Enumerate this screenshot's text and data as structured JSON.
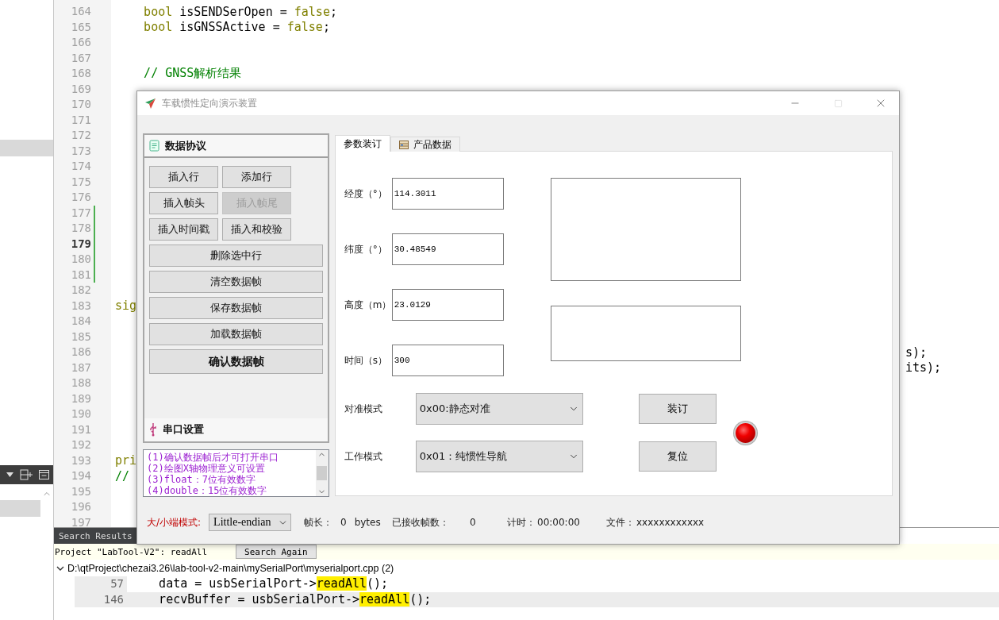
{
  "editor": {
    "lines": [
      {
        "number": "164",
        "current": false,
        "changed": false,
        "code": [
          {
            "kind": "keyword",
            "text": "    bool"
          },
          {
            "kind": "plain",
            "text": " isSENDSerOpen = "
          },
          {
            "kind": "keyword",
            "text": "false"
          },
          {
            "kind": "plain",
            "text": ";"
          }
        ]
      },
      {
        "number": "165",
        "current": false,
        "changed": false,
        "code": [
          {
            "kind": "keyword",
            "text": "    bool"
          },
          {
            "kind": "plain",
            "text": " isGNSSActive = "
          },
          {
            "kind": "keyword",
            "text": "false"
          },
          {
            "kind": "plain",
            "text": ";"
          }
        ]
      },
      {
        "number": "166",
        "current": false,
        "changed": false
      },
      {
        "number": "167",
        "current": false,
        "changed": false
      },
      {
        "number": "168",
        "current": false,
        "changed": false,
        "code": [
          {
            "kind": "comment",
            "text": "    // GNSS解析结果"
          }
        ]
      },
      {
        "number": "169",
        "current": false,
        "changed": false
      },
      {
        "number": "170",
        "current": false,
        "changed": false
      },
      {
        "number": "171",
        "current": false,
        "changed": false
      },
      {
        "number": "172",
        "current": false,
        "changed": false
      },
      {
        "number": "173",
        "current": false,
        "changed": false
      },
      {
        "number": "174",
        "current": false,
        "changed": false
      },
      {
        "number": "175",
        "current": false,
        "changed": false
      },
      {
        "number": "176",
        "current": false,
        "changed": false
      },
      {
        "number": "177",
        "current": false,
        "changed": true
      },
      {
        "number": "178",
        "current": false,
        "changed": true
      },
      {
        "number": "179",
        "current": true,
        "changed": true
      },
      {
        "number": "180",
        "current": false,
        "changed": true
      },
      {
        "number": "181",
        "current": false,
        "changed": true
      },
      {
        "number": "182",
        "current": false,
        "changed": false
      },
      {
        "number": "183",
        "current": false,
        "changed": false,
        "code": [
          {
            "kind": "keyword",
            "text": "sig"
          }
        ]
      },
      {
        "number": "184",
        "current": false,
        "changed": false
      },
      {
        "number": "185",
        "current": false,
        "changed": false
      },
      {
        "number": "186",
        "current": false,
        "changed": false,
        "tail": "s);"
      },
      {
        "number": "187",
        "current": false,
        "changed": false,
        "tail": "its);"
      },
      {
        "number": "188",
        "current": false,
        "changed": false
      },
      {
        "number": "189",
        "current": false,
        "changed": false
      },
      {
        "number": "190",
        "current": false,
        "changed": false
      },
      {
        "number": "191",
        "current": false,
        "changed": false
      },
      {
        "number": "192",
        "current": false,
        "changed": false
      },
      {
        "number": "193",
        "current": false,
        "changed": false,
        "code": [
          {
            "kind": "keyword",
            "text": "pri"
          }
        ]
      },
      {
        "number": "194",
        "current": false,
        "changed": false,
        "code": [
          {
            "kind": "comment",
            "text": "//"
          }
        ]
      },
      {
        "number": "195",
        "current": false,
        "changed": false
      },
      {
        "number": "196",
        "current": false,
        "changed": false
      },
      {
        "number": "197",
        "current": false,
        "changed": false
      }
    ]
  },
  "search_results": {
    "title": "Search Results",
    "query": "Project \"LabTool-V2\": readAll",
    "search_again": "Search Again",
    "file": {
      "path": "D:\\qtProject\\chezai3.26\\lab-tool-v2-main\\mySerialPort\\myserialport.cpp (2)",
      "expanded": true
    },
    "results": [
      {
        "line": "57",
        "before": "    data = usbSerialPort->",
        "match": "readAll",
        "after": "();",
        "selected": false
      },
      {
        "line": "146",
        "before": "    recvBuffer = usbSerialPort->",
        "match": "readAll",
        "after": "();",
        "selected": true
      }
    ]
  },
  "window": {
    "title": "车载惯性定向演示装置",
    "controls": [
      {
        "kind": "minimize",
        "disabled": false
      },
      {
        "kind": "maximize",
        "disabled": true
      },
      {
        "kind": "close",
        "disabled": false
      }
    ]
  },
  "toolbox": {
    "sections": [
      {
        "title": "数据协议"
      },
      {
        "title": "串口设置"
      }
    ],
    "buttons": [
      {
        "label": "插入行",
        "kind": "half",
        "disabled": false
      },
      {
        "label": "添加行",
        "kind": "half",
        "disabled": false
      },
      {
        "label": "插入帧头",
        "kind": "half",
        "disabled": false
      },
      {
        "label": "插入帧尾",
        "kind": "half",
        "disabled": true
      },
      {
        "label": "插入时间戳",
        "kind": "half",
        "disabled": false
      },
      {
        "label": "插入和校验",
        "kind": "half",
        "disabled": false
      },
      {
        "label": "删除选中行",
        "kind": "full",
        "disabled": false
      },
      {
        "label": "清空数据帧",
        "kind": "full",
        "disabled": false
      },
      {
        "label": "保存数据帧",
        "kind": "full",
        "disabled": false
      },
      {
        "label": "加载数据帧",
        "kind": "full",
        "disabled": false
      },
      {
        "label": "确认数据帧",
        "kind": "primary",
        "disabled": false
      }
    ]
  },
  "notes": [
    "(1)确认数据帧后才可打开串口",
    "(2)绘图X轴物理意义可设置",
    "(3)float：7位有效数字",
    "(4)double：15位有效数字"
  ],
  "tabs": [
    {
      "label": "参数装订",
      "selected": true
    },
    {
      "label": "产品数据",
      "selected": false
    }
  ],
  "fields": [
    {
      "label": "经度（°）",
      "value": "114.3011"
    },
    {
      "label": "纬度（°）",
      "value": "30.48549"
    },
    {
      "label": "高度（m）",
      "value": "23.0129"
    },
    {
      "label": "时间（s）",
      "value": "300"
    }
  ],
  "modes": [
    {
      "label": "对准模式",
      "value": "0x00:静态对准"
    },
    {
      "label": "工作模式",
      "value": "0x01：纯惯性导航"
    }
  ],
  "actions": [
    "装订",
    "复位"
  ],
  "status": {
    "endian": {
      "label": "大/小端模式:",
      "value": "Little-endian"
    },
    "frame_length": {
      "label": "帧长：",
      "value": "0",
      "unit": "bytes"
    },
    "received": {
      "label": "已接收帧数：",
      "value": "0"
    },
    "timer": {
      "label": "计时：",
      "value": "00:00:00"
    },
    "file": {
      "label": "文件：",
      "value": "xxxxxxxxxxxx"
    }
  }
}
